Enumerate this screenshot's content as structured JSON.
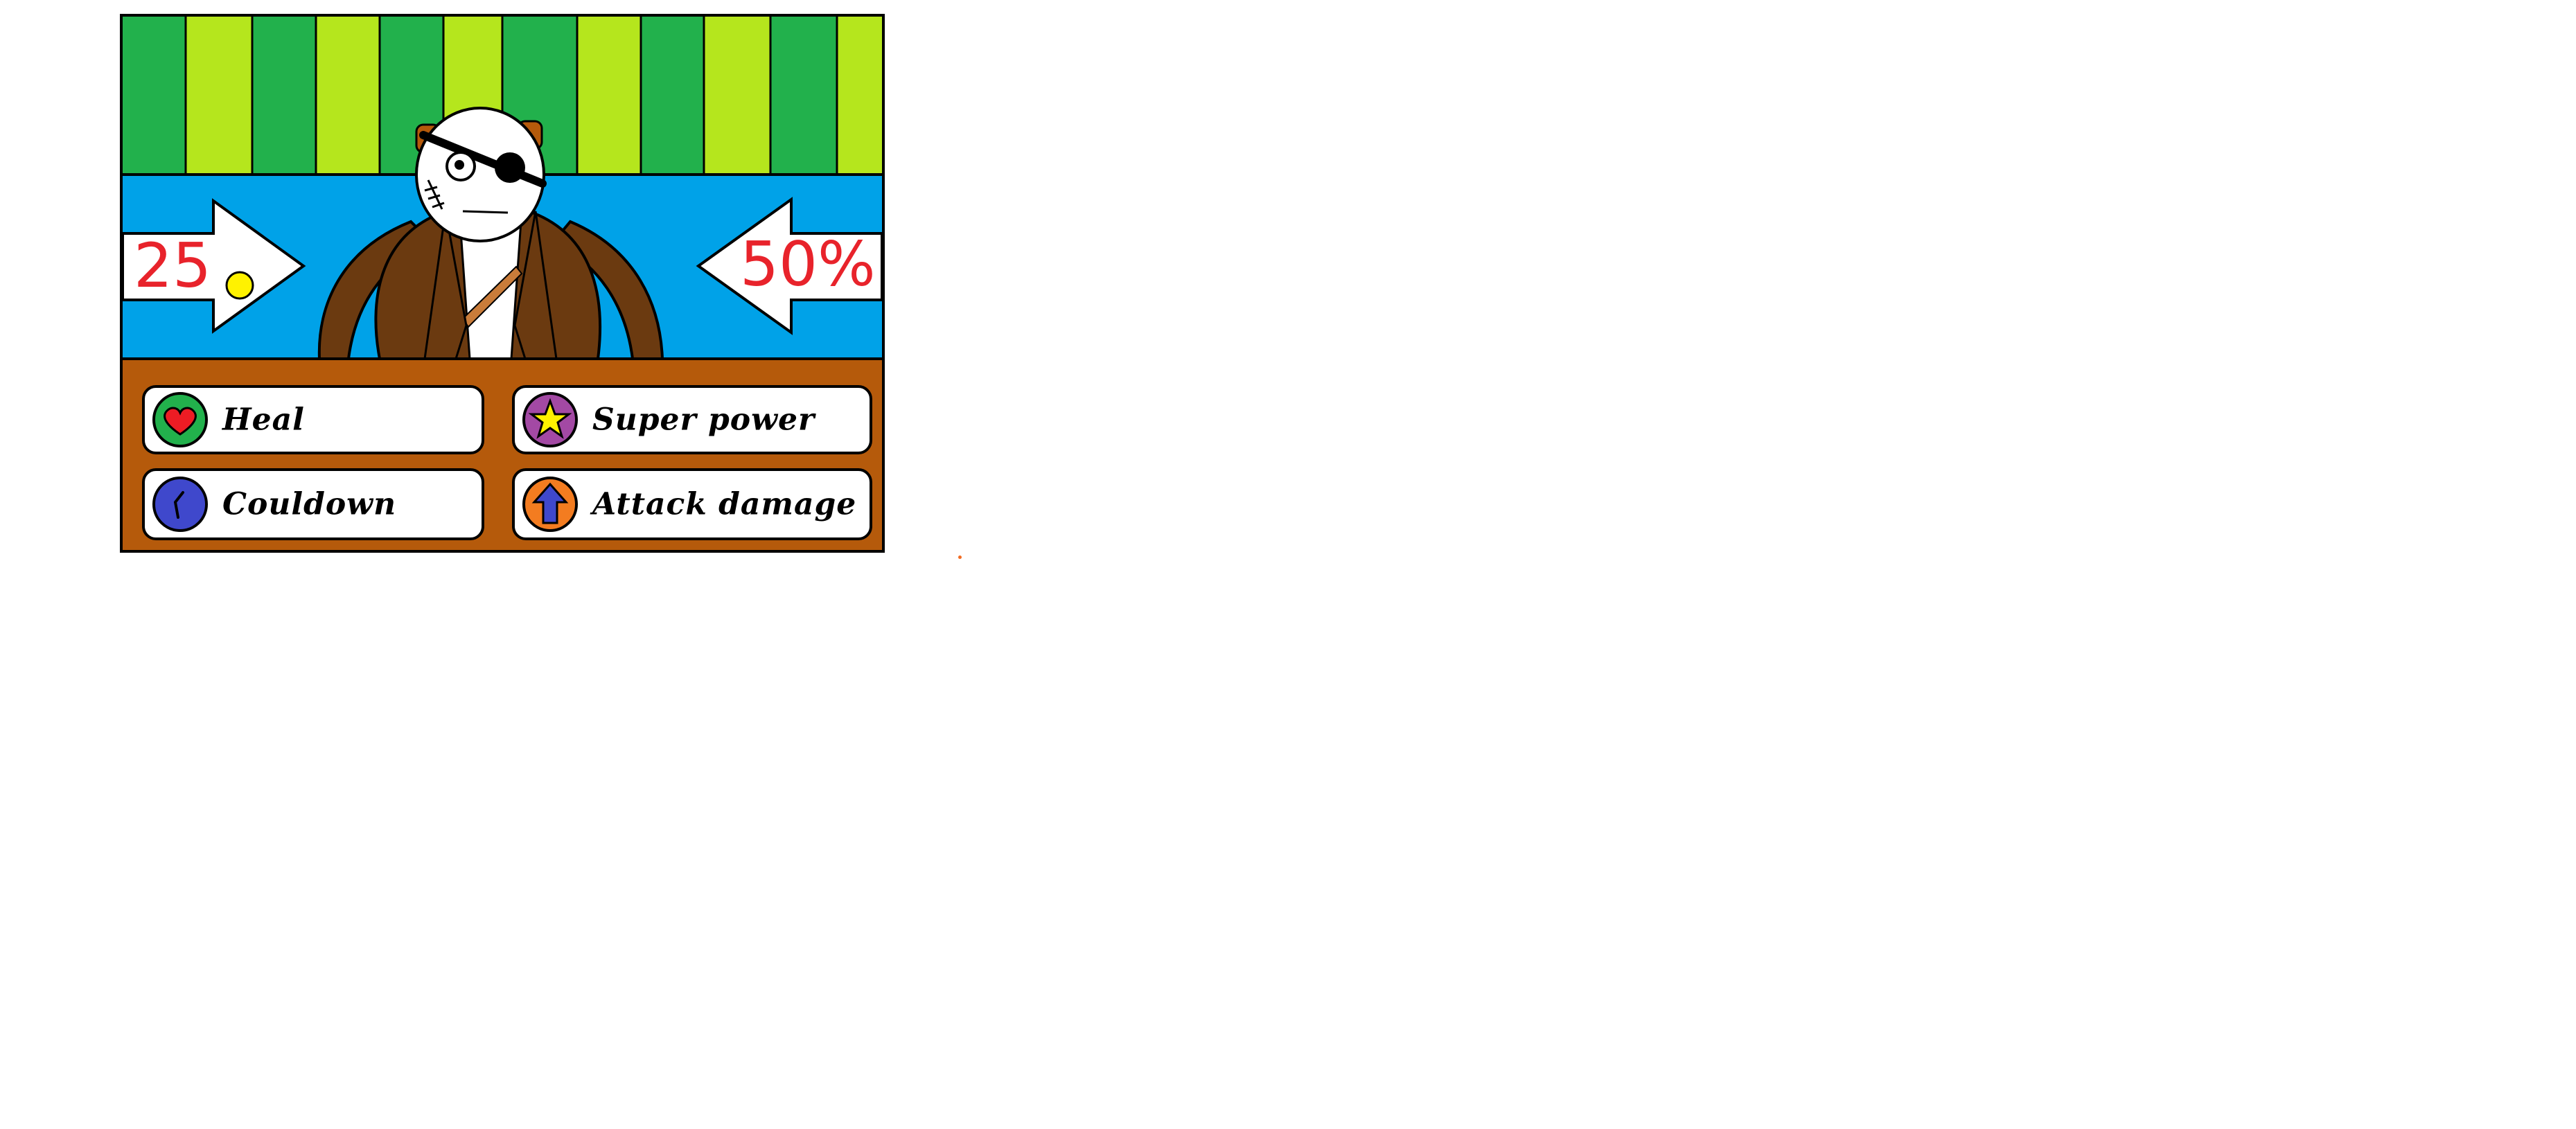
{
  "hud": {
    "left_value": "25",
    "right_value": "50%",
    "left_value_color": "#e8232b",
    "right_value_color": "#e8232b",
    "coin_color": "#fff200"
  },
  "actions": [
    {
      "label": "Heal",
      "icon": "heart-icon",
      "icon_bg": "#22b14c",
      "icon_fg": "#ed1c24"
    },
    {
      "label": "Super power",
      "icon": "star-icon",
      "icon_bg": "#a349a4",
      "icon_fg": "#fff200"
    },
    {
      "label": "Couldown",
      "icon": "clock-icon",
      "icon_bg": "#3f48cc",
      "icon_fg": "#000000"
    },
    {
      "label": "Attack damage",
      "icon": "arrow-up-icon",
      "icon_bg": "#f37c20",
      "icon_fg": "#3f48cc"
    }
  ],
  "palette": {
    "stripe_dark": "#22b14c",
    "stripe_light": "#b5e61d",
    "sky": "#00a2e8",
    "panel": "#b55a0b",
    "coat": "#6b3a10"
  }
}
